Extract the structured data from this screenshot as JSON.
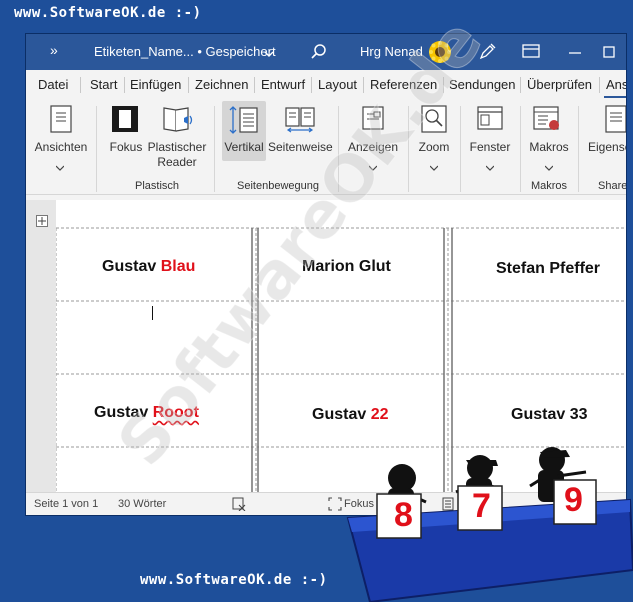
{
  "watermark": {
    "top": "www.SoftwareOK.de :-)",
    "bottom": "www.SoftwareOK.de :-)",
    "diagonal": "SoftwareOK.de"
  },
  "titlebar": {
    "more_label": "»",
    "doc_title": "Etiketen_Name... • Gespeichert",
    "user_name": "Hrg Nenad"
  },
  "menu": [
    "Datei",
    "Start",
    "Einfügen",
    "Zeichnen",
    "Entwurf",
    "Layout",
    "Referenzen",
    "Sendungen",
    "Überprüfen",
    "Ans"
  ],
  "ribbon": {
    "ansichten": "Ansichten",
    "fokus": "Fokus",
    "plastischer_reader_1": "Plastischer",
    "plastischer_reader_2": "Reader",
    "group_plastisch": "Plastisch",
    "vertikal": "Vertikal",
    "seitenweise": "Seitenweise",
    "group_seitenbewegung": "Seitenbewegung",
    "anzeigen": "Anzeigen",
    "zoom": "Zoom",
    "fenster": "Fenster",
    "makros": "Makros",
    "group_makros": "Makros",
    "eigenschaften": "Eigensc",
    "group_share": "Share"
  },
  "labels": {
    "r1c1_first": "Gustav",
    "r1c1_second": "Blau",
    "r1c2": "Marion Glut",
    "r1c3": "Stefan Pfeffer",
    "r3c1_first": "Gustav",
    "r3c1_second": "Rooot",
    "r3c2_first": "Gustav",
    "r3c2_second": "22",
    "r3c3": "Gustav 33"
  },
  "status": {
    "page": "Seite 1 von 1",
    "words": "30 Wörter",
    "focus": "Fokus"
  },
  "judges": [
    "8",
    "7",
    "9"
  ],
  "colors": {
    "accent": "#2b579a",
    "red": "#e0101a",
    "page_bg": "#1e4f9a"
  }
}
